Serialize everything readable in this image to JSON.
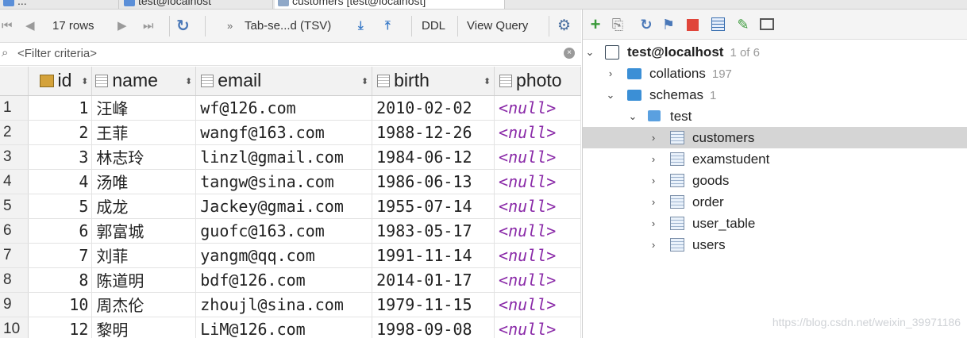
{
  "tabs": [
    {
      "label": "..."
    },
    {
      "label": "test@localhost"
    },
    {
      "label": "customers [test@localhost]"
    }
  ],
  "result_toolbar": {
    "rows": "17 rows",
    "export_format": "Tab-se...d (TSV)",
    "ddl_label": "DDL",
    "view_query_label": "View Query"
  },
  "filter": {
    "placeholder": "<Filter criteria>"
  },
  "columns": [
    "id",
    "name",
    "email",
    "birth",
    "photo"
  ],
  "rows": [
    {
      "num": "1",
      "id": "1",
      "name": "汪峰",
      "email": "wf@126.com",
      "birth": "2010-02-02",
      "photo": "<null>"
    },
    {
      "num": "2",
      "id": "2",
      "name": "王菲",
      "email": "wangf@163.com",
      "birth": "1988-12-26",
      "photo": "<null>"
    },
    {
      "num": "3",
      "id": "3",
      "name": "林志玲",
      "email": "linzl@gmail.com",
      "birth": "1984-06-12",
      "photo": "<null>"
    },
    {
      "num": "4",
      "id": "4",
      "name": "汤唯",
      "email": "tangw@sina.com",
      "birth": "1986-06-13",
      "photo": "<null>"
    },
    {
      "num": "5",
      "id": "5",
      "name": "成龙",
      "email": "Jackey@gmai.com",
      "birth": "1955-07-14",
      "photo": "<null>"
    },
    {
      "num": "6",
      "id": "6",
      "name": "郭富城",
      "email": "guofc@163.com",
      "birth": "1983-05-17",
      "photo": "<null>"
    },
    {
      "num": "7",
      "id": "7",
      "name": "刘菲",
      "email": "yangm@qq.com",
      "birth": "1991-11-14",
      "photo": "<null>"
    },
    {
      "num": "8",
      "id": "8",
      "name": "陈道明",
      "email": "bdf@126.com",
      "birth": "2014-01-17",
      "photo": "<null>"
    },
    {
      "num": "9",
      "id": "10",
      "name": "周杰伦",
      "email": "zhoujl@sina.com",
      "birth": "1979-11-15",
      "photo": "<null>"
    },
    {
      "num": "10",
      "id": "12",
      "name": "黎明",
      "email": "LiM@126.com",
      "birth": "1998-09-08",
      "photo": "<null>"
    }
  ],
  "tree": {
    "host": {
      "label": "test@localhost",
      "count": "1 of 6"
    },
    "collations": {
      "label": "collations",
      "count": "197"
    },
    "schemas": {
      "label": "schemas",
      "count": "1"
    },
    "schema": {
      "label": "test"
    },
    "tables": [
      "customers",
      "examstudent",
      "goods",
      "order",
      "user_table",
      "users"
    ]
  },
  "watermark": "https://blog.csdn.net/weixin_39971186",
  "colors": {
    "null_value": "#8a2aa8",
    "selection": "#d5d5d5",
    "folder": "#3b8fd6"
  }
}
